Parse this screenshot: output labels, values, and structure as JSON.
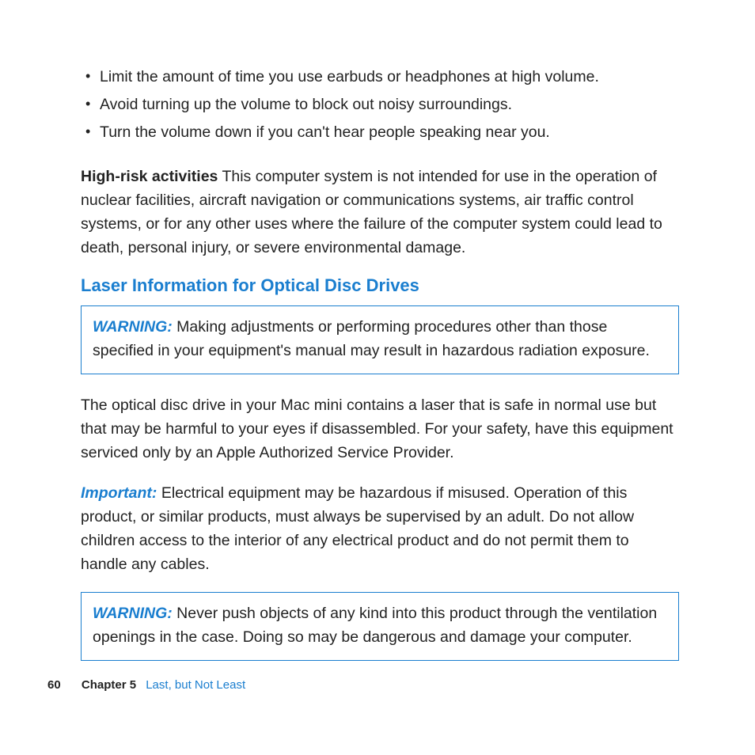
{
  "bullets": {
    "b0": "Limit the amount of time you use earbuds or headphones at high volume.",
    "b1": "Avoid turning up the volume to block out noisy surroundings.",
    "b2": "Turn the volume down if you can't hear people speaking near you."
  },
  "highrisk": {
    "label": "High-risk activities",
    "text": "  This computer system is not intended for use in the operation of nuclear facilities, aircraft navigation or communications systems, air traffic control systems, or for any other uses where the failure of the computer system could lead to death, personal injury, or severe environmental damage."
  },
  "section_heading": "Laser Information for Optical Disc Drives",
  "warning1": {
    "label": "WARNING:",
    "text": "  Making adjustments or performing procedures other than those specified in your equipment's manual may result in hazardous radiation exposure."
  },
  "optical_para": "The optical disc drive in your Mac mini contains a laser that is safe in normal use but that may be harmful to your eyes if disassembled. For your safety, have this equipment serviced only by an Apple Authorized Service Provider.",
  "important": {
    "label": "Important:",
    "text": "  Electrical equipment may be hazardous if misused. Operation of this product, or similar products, must always be supervised by an adult. Do not allow children access to the interior of any electrical product and do not permit them to handle any cables."
  },
  "warning2": {
    "label": "WARNING:",
    "text": "  Never push objects of any kind into this product through the ventilation openings in the case. Doing so may be dangerous and damage your computer."
  },
  "footer": {
    "pageno": "60",
    "chapter": "Chapter 5",
    "title": "Last, but Not Least"
  }
}
